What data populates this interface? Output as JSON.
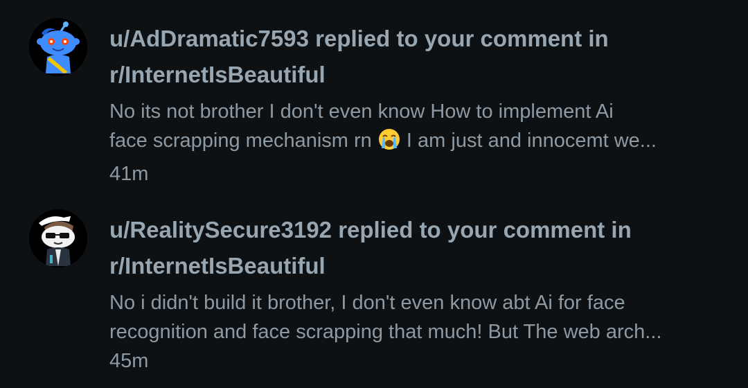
{
  "notifications": [
    {
      "user": "u/AdDramatic7593",
      "action": "replied to your comment in",
      "subreddit": "r/InternetIsBeautiful",
      "line1": "No its not brother I don't even know How to implement Ai",
      "line2_before": "face scrapping mechanism rn",
      "emoji": "loudly-crying-face-emoji",
      "line2_after": "I am just and innocemt we...",
      "time": "41m",
      "avatar": "blue-snoo-avatar-icon"
    },
    {
      "user": "u/RealitySecure3192",
      "action": "replied to your comment in",
      "subreddit": "r/InternetIsBeautiful",
      "line1": "No i didn't build it brother, I don't even know abt Ai for face",
      "line2": "recognition and face scrapping that much! But The web arch...",
      "time": "45m",
      "avatar": "sunglasses-snoo-avatar-icon"
    }
  ],
  "colors": {
    "background": "#0e1113",
    "title": "#97a6b0",
    "body": "#8d9aa3"
  }
}
